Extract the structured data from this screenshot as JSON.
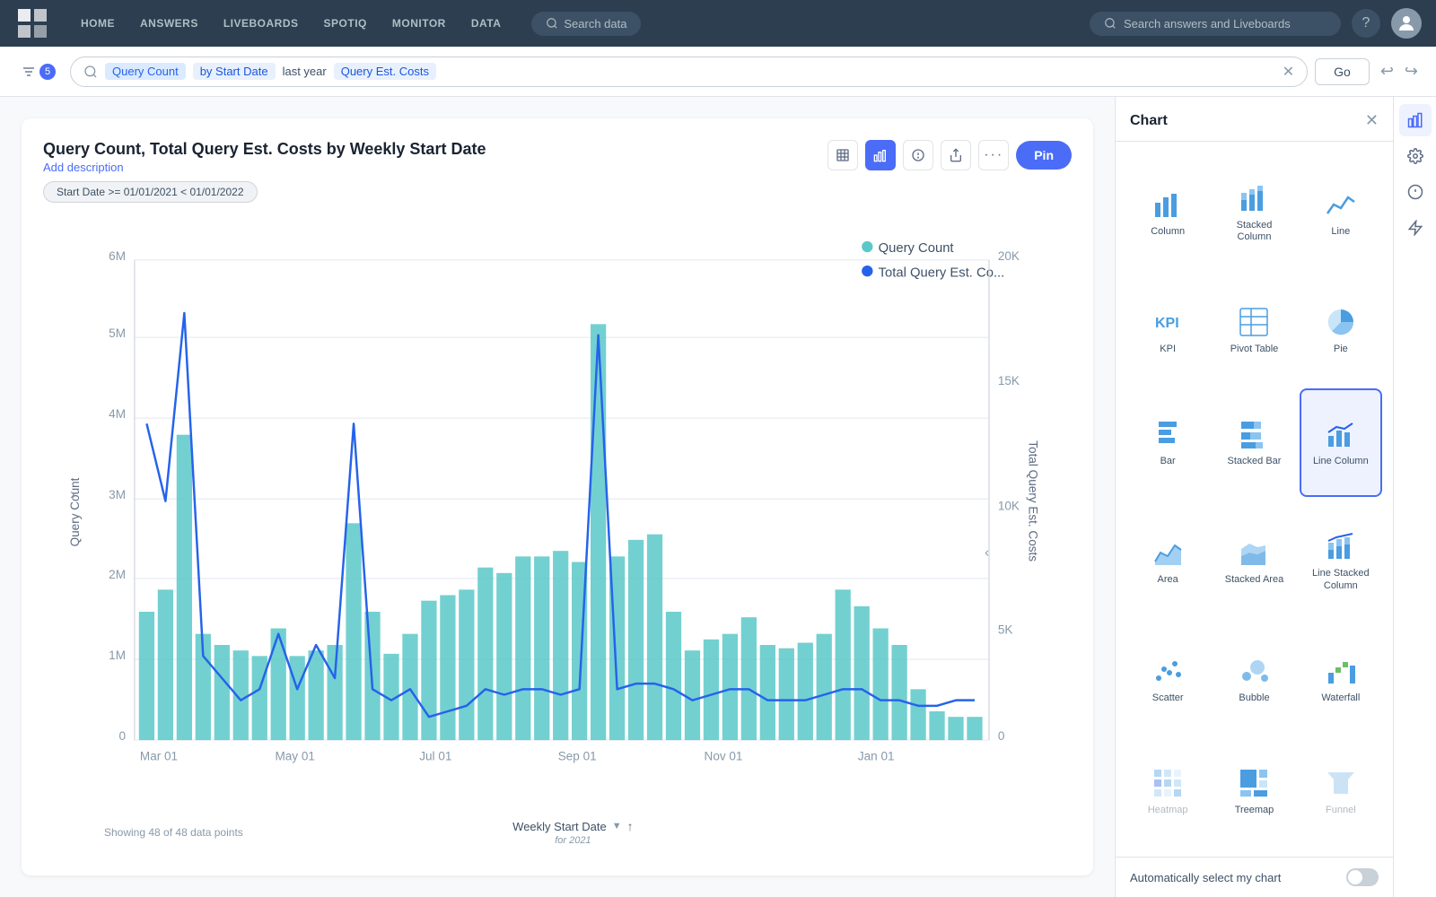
{
  "nav": {
    "links": [
      "HOME",
      "ANSWERS",
      "LIVEBOARDS",
      "SPOTIQ",
      "MONITOR",
      "DATA"
    ],
    "search_data_placeholder": "Search data",
    "search_answers_placeholder": "Search answers and Liveboards"
  },
  "search_bar": {
    "filter_count": "5",
    "chips": [
      "Query Count",
      "by Start Date",
      "last year",
      "Query Est. Costs"
    ],
    "go_label": "Go"
  },
  "chart": {
    "title": "Query Count, Total Query Est. Costs by Weekly Start Date",
    "subtitle": "Add description",
    "date_filter": "Start Date >= 01/01/2021 < 01/01/2022",
    "legend": [
      {
        "label": "Query Count",
        "color": "#5bc8c8"
      },
      {
        "label": "Total Query Est. Co...",
        "color": "#2563eb"
      }
    ],
    "x_axis_label": "Weekly Start Date",
    "x_axis_sub": "for 2021",
    "y_left_label": "Query Count",
    "y_right_label": "Total Query Est. Costs",
    "data_points": "Showing 48 of 48 data points",
    "pin_label": "Pin"
  },
  "chart_panel": {
    "title": "Chart",
    "chart_types": [
      {
        "id": "column",
        "label": "Column",
        "icon": "column"
      },
      {
        "id": "stacked-column",
        "label": "Stacked Column",
        "icon": "stacked-column"
      },
      {
        "id": "line",
        "label": "Line",
        "icon": "line"
      },
      {
        "id": "kpi",
        "label": "KPI",
        "icon": "kpi"
      },
      {
        "id": "pivot-table",
        "label": "Pivot Table",
        "icon": "pivot-table"
      },
      {
        "id": "pie",
        "label": "Pie",
        "icon": "pie"
      },
      {
        "id": "bar",
        "label": "Bar",
        "icon": "bar"
      },
      {
        "id": "stacked-bar",
        "label": "Stacked Bar",
        "icon": "stacked-bar"
      },
      {
        "id": "line-column",
        "label": "Line Column",
        "icon": "line-column",
        "selected": true
      },
      {
        "id": "area",
        "label": "Area",
        "icon": "area"
      },
      {
        "id": "stacked-area",
        "label": "Stacked Area",
        "icon": "stacked-area"
      },
      {
        "id": "line-stacked-column",
        "label": "Line Stacked Column",
        "icon": "line-stacked-column"
      },
      {
        "id": "scatter",
        "label": "Scatter",
        "icon": "scatter"
      },
      {
        "id": "bubble",
        "label": "Bubble",
        "icon": "bubble"
      },
      {
        "id": "waterfall",
        "label": "Waterfall",
        "icon": "waterfall"
      },
      {
        "id": "heatmap",
        "label": "Heatmap",
        "icon": "heatmap",
        "disabled": true
      },
      {
        "id": "treemap",
        "label": "Treemap",
        "icon": "treemap"
      },
      {
        "id": "funnel",
        "label": "Funnel",
        "icon": "funnel",
        "disabled": true
      }
    ],
    "auto_select_label": "Automatically select my chart"
  }
}
